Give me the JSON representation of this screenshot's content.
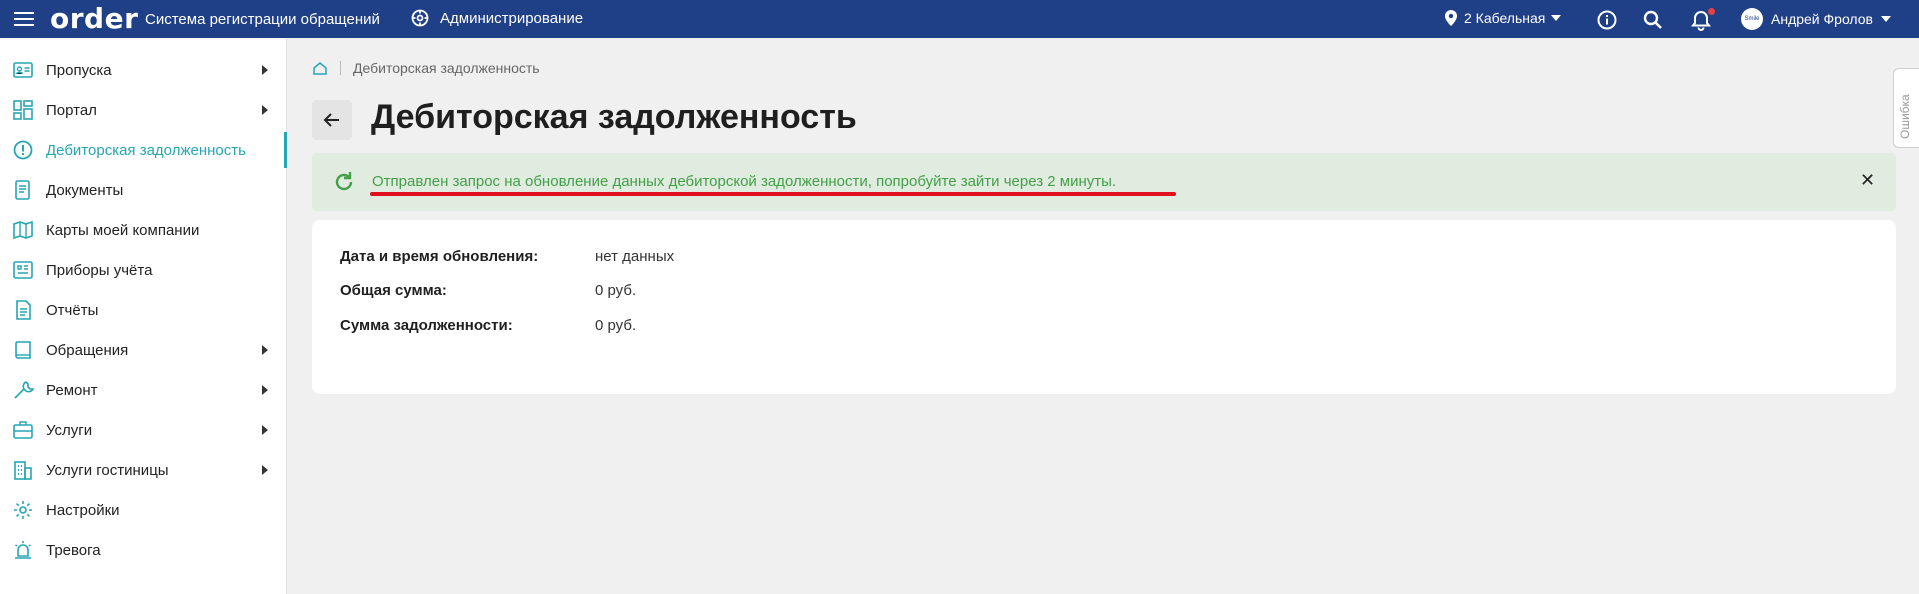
{
  "topbar": {
    "logo": "order",
    "app_name": "Система регистрации обращений",
    "admin_label": "Администрирование",
    "location": "2 Кабельная",
    "user_name": "Андрей Фролов",
    "avatar_text": "Smile"
  },
  "sidebar": {
    "items": [
      {
        "label": "Пропуска",
        "icon": "id-card-icon",
        "has_arrow": true
      },
      {
        "label": "Портал",
        "icon": "dashboard-icon",
        "has_arrow": true
      },
      {
        "label": "Дебиторская задолженность",
        "icon": "alert-circle-icon",
        "active": true
      },
      {
        "label": "Документы",
        "icon": "document-icon"
      },
      {
        "label": "Карты моей компании",
        "icon": "map-icon"
      },
      {
        "label": "Приборы учёта",
        "icon": "meter-icon"
      },
      {
        "label": "Отчёты",
        "icon": "report-icon"
      },
      {
        "label": "Обращения",
        "icon": "book-icon",
        "has_arrow": true
      },
      {
        "label": "Ремонт",
        "icon": "wrench-icon",
        "has_arrow": true
      },
      {
        "label": "Услуги",
        "icon": "briefcase-icon",
        "has_arrow": true
      },
      {
        "label": "Услуги гостиницы",
        "icon": "hotel-icon",
        "has_arrow": true
      },
      {
        "label": "Настройки",
        "icon": "gear-icon"
      },
      {
        "label": "Тревога",
        "icon": "alarm-icon"
      }
    ]
  },
  "breadcrumb": {
    "current": "Дебиторская задолженность"
  },
  "page": {
    "title": "Дебиторская задолженность"
  },
  "alert": {
    "message": "Отправлен запрос на обновление данных дебиторской задолженности, попробуйте зайти через 2 минуты."
  },
  "details": [
    {
      "label": "Дата и время обновления:",
      "value": "нет данных"
    },
    {
      "label": "Общая сумма:",
      "value": "0 руб."
    },
    {
      "label": "Сумма задолженности:",
      "value": "0 руб."
    }
  ],
  "side_tab": {
    "label": "Ошибка"
  },
  "colors": {
    "topbar": "#1f3f86",
    "accent": "#26a6b4",
    "alert_bg": "#e1ece1",
    "alert_text": "#43a047",
    "underline": "#e0101e"
  }
}
